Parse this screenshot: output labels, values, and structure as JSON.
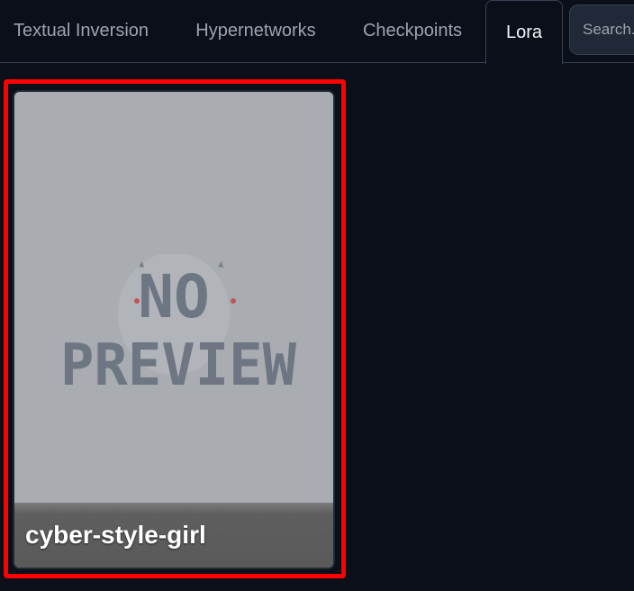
{
  "tabs": [
    {
      "label": "Textual Inversion",
      "active": false
    },
    {
      "label": "Hypernetworks",
      "active": false
    },
    {
      "label": "Checkpoints",
      "active": false
    },
    {
      "label": "Lora",
      "active": true
    }
  ],
  "search": {
    "placeholder": "Search..."
  },
  "cards": [
    {
      "title": "cyber-style-girl",
      "preview_text_line1": "NO",
      "preview_text_line2": "PREVIEW"
    }
  ],
  "colors": {
    "background": "#0b0f19",
    "highlight": "#ff0000",
    "tab_inactive_text": "#9ca3af",
    "tab_active_text": "#f3f4f6"
  }
}
